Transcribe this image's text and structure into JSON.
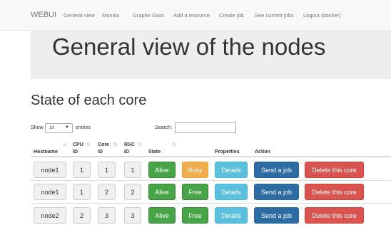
{
  "navbar": {
    "brand": "WEBUI",
    "links": [
      "General view",
      "Monika",
      "Graphe Gant",
      "Add a resource",
      "Create job",
      "See current jobs",
      "Logout (docker)"
    ]
  },
  "jumbotron": {
    "title": "General view of the nodes"
  },
  "section": {
    "title": "State of each core"
  },
  "table_controls": {
    "show_label": "Show",
    "entries_value": "10",
    "entries_label": "entries",
    "search_label": "Search:",
    "search_value": ""
  },
  "table": {
    "headers": {
      "hostname": "Hostname",
      "cpu_id": [
        "CPU",
        "ID"
      ],
      "core_id": [
        "Core",
        "ID"
      ],
      "rsc_id": [
        "RSC",
        "ID"
      ],
      "state": "State",
      "properties": "Properties",
      "action": "Action"
    },
    "rows": [
      {
        "hostname": "node1",
        "cpu": "1",
        "core": "1",
        "rsc": "1",
        "state": "Alive",
        "status": "Busy",
        "status_type": "warning",
        "properties": "Details",
        "send": "Send a job",
        "delete": "Delete this core"
      },
      {
        "hostname": "node1",
        "cpu": "1",
        "core": "2",
        "rsc": "2",
        "state": "Alive",
        "status": "Free",
        "status_type": "success",
        "properties": "Details",
        "send": "Send a job",
        "delete": "Delete this core"
      },
      {
        "hostname": "node2",
        "cpu": "2",
        "core": "3",
        "rsc": "3",
        "state": "Alive",
        "status": "Free",
        "status_type": "success",
        "properties": "Details",
        "send": "Send a job",
        "delete": "Delete this core"
      }
    ]
  },
  "colors": {
    "success": "#47a447",
    "warning": "#f0ad4e",
    "info": "#5bc0de",
    "primary": "#2d6ca2",
    "danger": "#d9534f"
  }
}
